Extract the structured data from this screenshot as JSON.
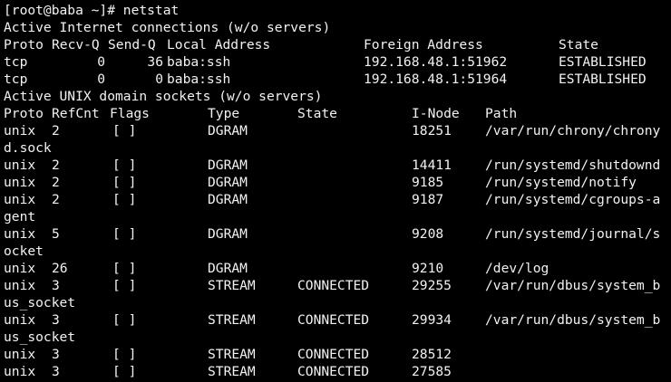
{
  "terminal": {
    "prompt": "[root@baba ~]# netstat",
    "inet_heading": "Active Internet connections (w/o servers)",
    "inet_header": {
      "proto": "Proto",
      "recvq": "Recv-Q",
      "sendq": "Send-Q",
      "local": "Local Address",
      "foreign": "Foreign Address",
      "state": "State"
    },
    "inet_rows": [
      {
        "proto": "tcp",
        "recvq": "0",
        "sendq": "36",
        "local": "baba:ssh",
        "foreign": "192.168.48.1:51962",
        "state": "ESTABLISHED"
      },
      {
        "proto": "tcp",
        "recvq": "0",
        "sendq": "0",
        "local": "baba:ssh",
        "foreign": "192.168.48.1:51964",
        "state": "ESTABLISHED"
      }
    ],
    "unix_heading": "Active UNIX domain sockets (w/o servers)",
    "unix_header": {
      "proto": "Proto",
      "refcnt": "RefCnt",
      "flags": "Flags",
      "type": "Type",
      "state": "State",
      "inode": "I-Node",
      "path": "Path"
    },
    "unix_rows": [
      {
        "proto": "unix",
        "refcnt": "2",
        "flags": "[ ]",
        "type": "DGRAM",
        "state": "",
        "inode": "18251",
        "path": "/var/run/chrony/chrony",
        "wrap": "d.sock"
      },
      {
        "proto": "unix",
        "refcnt": "2",
        "flags": "[ ]",
        "type": "DGRAM",
        "state": "",
        "inode": "14411",
        "path": "/run/systemd/shutdownd",
        "wrap": ""
      },
      {
        "proto": "unix",
        "refcnt": "2",
        "flags": "[ ]",
        "type": "DGRAM",
        "state": "",
        "inode": "9185",
        "path": "/run/systemd/notify",
        "wrap": ""
      },
      {
        "proto": "unix",
        "refcnt": "2",
        "flags": "[ ]",
        "type": "DGRAM",
        "state": "",
        "inode": "9187",
        "path": "/run/systemd/cgroups-a",
        "wrap": "gent"
      },
      {
        "proto": "unix",
        "refcnt": "5",
        "flags": "[ ]",
        "type": "DGRAM",
        "state": "",
        "inode": "9208",
        "path": "/run/systemd/journal/s",
        "wrap": "ocket"
      },
      {
        "proto": "unix",
        "refcnt": "26",
        "flags": "[ ]",
        "type": "DGRAM",
        "state": "",
        "inode": "9210",
        "path": "/dev/log",
        "wrap": ""
      },
      {
        "proto": "unix",
        "refcnt": "3",
        "flags": "[ ]",
        "type": "STREAM",
        "state": "CONNECTED",
        "inode": "29255",
        "path": "/var/run/dbus/system_b",
        "wrap": "us_socket"
      },
      {
        "proto": "unix",
        "refcnt": "3",
        "flags": "[ ]",
        "type": "STREAM",
        "state": "CONNECTED",
        "inode": "29934",
        "path": "/var/run/dbus/system_b",
        "wrap": "us_socket"
      },
      {
        "proto": "unix",
        "refcnt": "3",
        "flags": "[ ]",
        "type": "STREAM",
        "state": "CONNECTED",
        "inode": "28512",
        "path": "",
        "wrap": ""
      },
      {
        "proto": "unix",
        "refcnt": "3",
        "flags": "[ ]",
        "type": "STREAM",
        "state": "CONNECTED",
        "inode": "27585",
        "path": "",
        "wrap": ""
      }
    ]
  }
}
